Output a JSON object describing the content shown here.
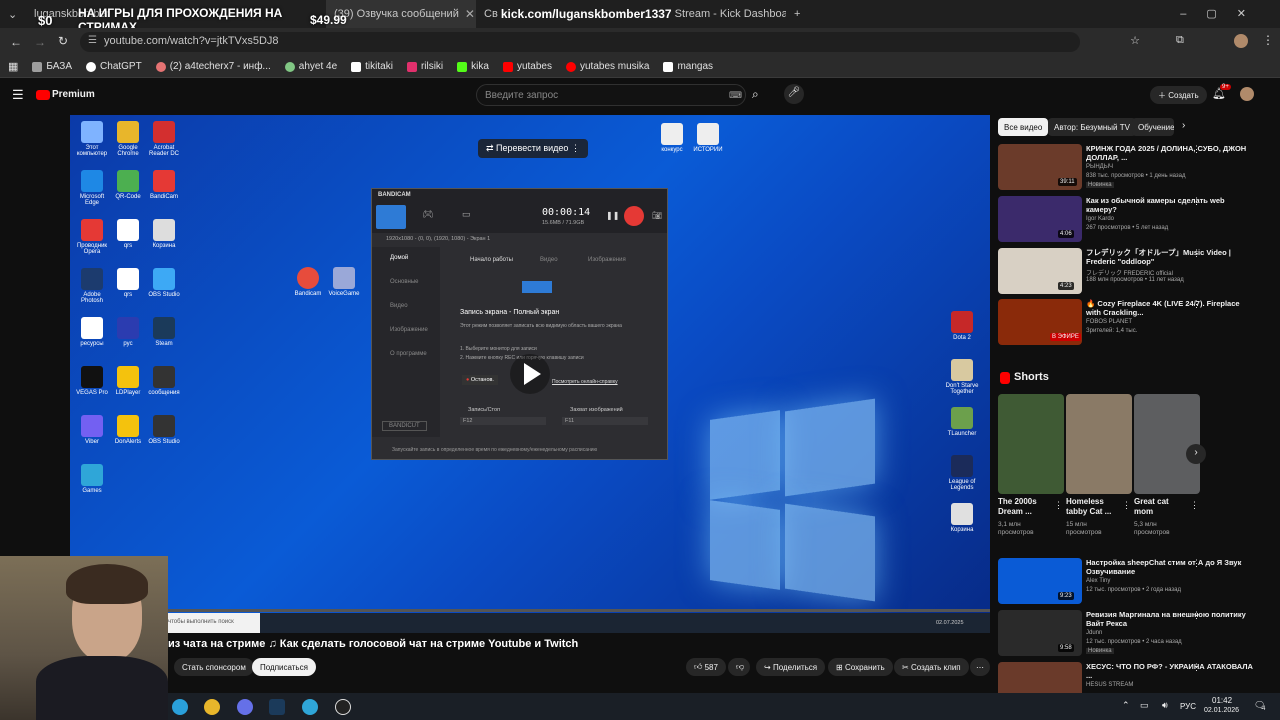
{
  "browser": {
    "tabs": [
      {
        "label": "luganskbomber"
      },
      {
        "label": "(39) Озвучка сообщений"
      },
      {
        "label": "Св"
      },
      {
        "label": "kick.com/luganskbomber1337"
      },
      {
        "label": "Stream - Kick Dashboard"
      }
    ],
    "overlay_banner": "НА ИГРЫ ДЛЯ ПРОХОЖДЕНИЯ НА СТРИМАХ",
    "overlay_left_amount": "$0",
    "overlay_right_amount": "$49.99",
    "url": "youtube.com/watch?v=jtkTVxs5DJ8",
    "bookmarks": [
      {
        "label": "БАЗА",
        "color": "#9e9e9e"
      },
      {
        "label": "ChatGPT",
        "color": "#ffffff"
      },
      {
        "label": "(2) a4techerx7 - инф...",
        "color": "#e57373"
      },
      {
        "label": "ahyet 4e",
        "color": "#81c784"
      },
      {
        "label": "tikitaki",
        "color": "#ffffff"
      },
      {
        "label": "rilsiki",
        "color": "#e1306c"
      },
      {
        "label": "kika",
        "color": "#53fc18"
      },
      {
        "label": "yutabes",
        "color": "#ff0000"
      },
      {
        "label": "yutabes musika",
        "color": "#ff0000"
      },
      {
        "label": "mangas",
        "color": "#ffffff"
      }
    ]
  },
  "youtube": {
    "logo_text": "Premium",
    "search_placeholder": "Введите запрос",
    "create_label": "Создать",
    "notif_count": "9+",
    "translate_label": "Перевести видео",
    "video_title": "из чата на стриме ♫ Как сделать голосовой чат на стриме Youtube и Twitch",
    "sponsor_label": "Стать спонсором",
    "subscribe_label": "Подписаться",
    "like_count": "587",
    "share_label": "Поделиться",
    "save_label": "Сохранить",
    "clip_label": "Создать клип",
    "progress_fraction": 0.02
  },
  "player": {
    "bandicam_title": "BANDICAM",
    "timer": "00:00:14",
    "size": "15.6MB / 71.9GB",
    "resolution_line": "1920x1080 - (0, 0), (1920, 1080) - Экран 1",
    "menu": [
      "Домой",
      "Основные",
      "Видео",
      "Изображение",
      "О программе"
    ],
    "top_tabs": [
      "Начало работы",
      "Видео",
      "Изображения"
    ],
    "section_title": "Запись экрана - Полный экран",
    "section_desc": "Этот режим позволяет записать всю видимую область вашего экрана",
    "steps": [
      "1. Выберите монитор для записи",
      "2. Нажмите кнопку REC или горячую клавишу записи"
    ],
    "stop_label": "Останов.",
    "help_link": "Посмотреть онлайн-справку",
    "hotkey1_label": "Запись/Стоп",
    "hotkey1": "F12",
    "hotkey2_label": "Захват изображений",
    "hotkey2": "F11",
    "footer": "Запускайте запись в определенное время по ежедневному/еженедельному расписанию",
    "bandicut": "BANDICUT",
    "search_taskbar": "чтобы выполнить поиск",
    "desktop_icons_left": [
      "Этот компьютер",
      "Google Chrome",
      "Acrobat Reader DC",
      "Microsoft Edge",
      "QR-Code",
      "BandiCam",
      "Проводник Opera",
      "qrs",
      "Корзина",
      "Adobe Photosh",
      "qrs",
      "OBS Studio",
      "ресурсы",
      "рус",
      "Steam",
      "VEGAS Pro",
      "LDPlayer",
      "сообщения",
      "Viber",
      "DonAlerts",
      "OBS Studio",
      "Games"
    ],
    "desktop_icons_right": [
      "Dota 2",
      "Don't Starve Together",
      "TLauncher",
      "League of Legends",
      "Корзина"
    ],
    "desktop_files": [
      "конкурс",
      "ИСТОРИИ"
    ],
    "desktop_center": [
      "Bandicam",
      "VoiceGame"
    ],
    "clock_inner": "02.07.2025"
  },
  "sidebar": {
    "chips": [
      "Все видео",
      "Автор: Безумный TV",
      "Обучение"
    ],
    "recommendations": [
      {
        "title": "КРИНЖ ГОДА 2025 / ДОЛИНА, СУБО, ДЖОН ДОЛЛАР, ...",
        "channel": "РЫНДЫЧ",
        "meta": "838 тыс. просмотров • 1 день назад",
        "badge": "Новинка",
        "duration": "39:11",
        "color": "#6b3b2a"
      },
      {
        "title": "Как из обычной камеры сделать web камеру?",
        "channel": "Igor Kardo",
        "meta": "267 просмотров • 5 лет назад",
        "badge": "",
        "duration": "4:06",
        "color": "#3b2a6b"
      },
      {
        "title": "フレデリック「オドループ」Music Video | Frederic \"oddloop\"",
        "channel": "フレデリック FREDERIC official",
        "meta": "188 млн просмотров • 11 лет назад",
        "badge": "",
        "duration": "4:23",
        "color": "#d8d0c4"
      },
      {
        "title": "🔥 Cozy Fireplace 4K (LIVE 24/7). Fireplace with Crackling...",
        "channel": "FOBOS PLANET",
        "meta": "Зрителей: 1,4 тыс.",
        "badge": "",
        "duration": "В ЭФИРЕ",
        "color": "#8a2a0a"
      }
    ],
    "shorts_title": "Shorts",
    "shorts": [
      {
        "title": "The 2000s Dream ...",
        "views": "3,1 млн просмотров",
        "color": "#3f5a34"
      },
      {
        "title": "Homeless tabby Cat ...",
        "views": "15 млн просмотров",
        "color": "#8a7a66"
      },
      {
        "title": "Great cat mom",
        "views": "5,3 млн просмотров",
        "color": "#5d5e60"
      }
    ],
    "recommendations2": [
      {
        "title": "Настройка sheepChat стим от А до Я Звук Озвучивание",
        "channel": "Alex Tiny",
        "meta": "12 тыс. просмотров • 2 года назад",
        "badge": "",
        "duration": "9:23",
        "color": "#0a5bd6"
      },
      {
        "title": "Ревизия Маргинала на внешнюю политику Вайт Рекса",
        "channel": "Jdunn",
        "meta": "12 тыс. просмотров • 2 часа назад",
        "badge": "Новинка",
        "duration": "9:58",
        "color": "#2a2a2a"
      },
      {
        "title": "ХЕСУС: ЧТО ПО РФ? - УКРАИНА АТАКОВАЛА ...",
        "channel": "HESUS STREAM",
        "meta": "",
        "badge": "",
        "duration": "",
        "color": "#6a3a2a"
      }
    ]
  },
  "taskbar": {
    "lang": "РУС",
    "time": "01:42",
    "date": "02.01.2026",
    "notif": "4"
  }
}
